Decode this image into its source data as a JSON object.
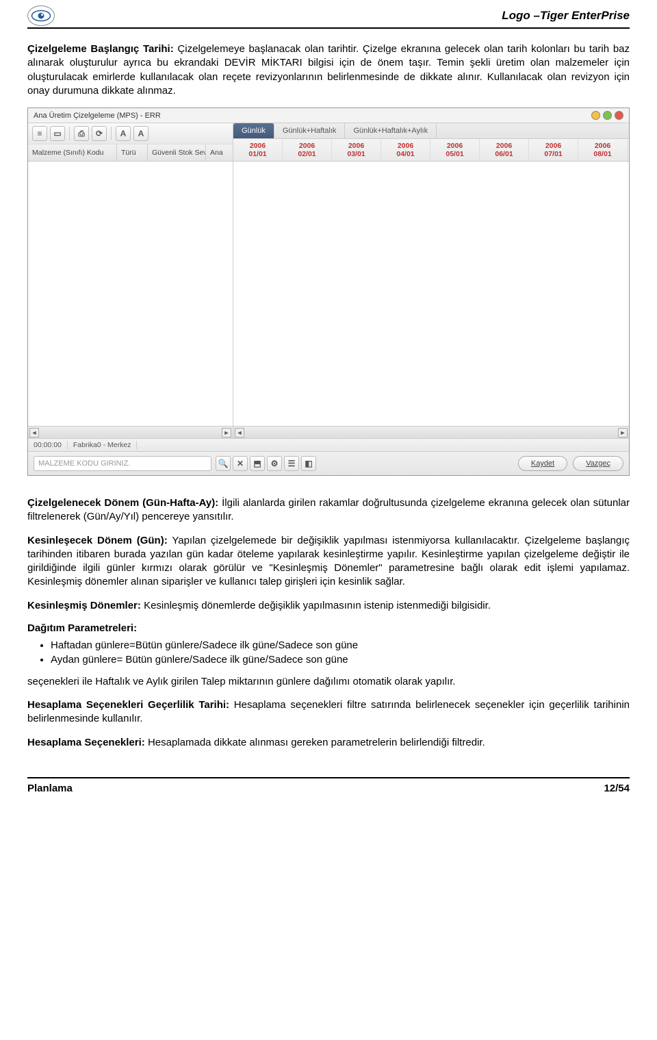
{
  "header": {
    "brand": "Logo –Tiger EnterPrise"
  },
  "paragraphs": {
    "p1_label": "Çizelgeleme Başlangıç Tarihi:",
    "p1_text": " Çizelgelemeye başlanacak olan tarihtir. Çizelge ekranına gelecek olan tarih kolonları bu tarih baz alınarak oluşturulur ayrıca bu ekrandaki DEVİR MİKTARI bilgisi için de önem taşır. Temin şekli üretim olan malzemeler için oluşturulacak emirlerde kullanılacak olan reçete revizyonlarının belirlenmesinde de dikkate alınır. Kullanılacak olan revizyon için onay durumuna dikkate alınmaz.",
    "p2_label": "Çizelgelenecek Dönem (Gün-Hafta-Ay):",
    "p2_text": " İlgili alanlarda girilen rakamlar doğrultusunda çizelgeleme ekranına gelecek olan sütunlar filtrelenerek (Gün/Ay/Yıl) pencereye yansıtılır.",
    "p3_label": "Kesinleşecek Dönem (Gün):",
    "p3_text": " Yapılan çizelgelemede bir değişiklik yapılması istenmiyorsa kullanılacaktır. Çizelgeleme başlangıç tarihinden itibaren burada yazılan gün kadar öteleme yapılarak kesinleştirme yapılır. Kesinleştirme yapılan çizelgeleme değiştir ile girildiğinde ilgili günler kırmızı olarak görülür ve \"Kesinleşmiş Dönemler\" parametresine bağlı olarak edit işlemi yapılamaz. Kesinleşmiş dönemler alınan siparişler ve kullanıcı talep girişleri için kesinlik sağlar.",
    "p4_label": "Kesinleşmiş Dönemler:",
    "p4_text": " Kesinleşmiş dönemlerde değişiklik yapılmasının istenip istenmediği bilgisidir.",
    "p5_label": "Dağıtım Parametreleri:",
    "bullet1": "Haftadan günlere=Bütün günlere/Sadece ilk güne/Sadece son güne",
    "bullet2": "Aydan günlere= Bütün günlere/Sadece ilk güne/Sadece son güne",
    "p6_text": "seçenekleri ile Haftalık ve Aylık girilen Talep miktarının günlere dağılımı otomatik olarak yapılır.",
    "p7_label": "Hesaplama Seçenekleri Geçerlilik Tarihi:",
    "p7_text": " Hesaplama seçenekleri filtre satırında belirlenecek seçenekler için geçerlilik tarihinin belirlenmesinde kullanılır.",
    "p8_label": "Hesaplama Seçenekleri:",
    "p8_text": " Hesaplamada dikkate alınması gereken parametrelerin belirlendiği filtredir."
  },
  "app": {
    "title": "Ana Üretim Çizelgeleme (MPS) - ERR",
    "left_columns": [
      "Malzeme (Sınıfı) Kodu",
      "Türü",
      "Güvenli Stok Seviyesi (a)",
      "Ana"
    ],
    "right_tabs": [
      "Günlük",
      "Günlük+Haftalık",
      "Günlük+Haftalık+Aylık"
    ],
    "dates": [
      {
        "y": "2006",
        "d": "01/01"
      },
      {
        "y": "2006",
        "d": "02/01"
      },
      {
        "y": "2006",
        "d": "03/01"
      },
      {
        "y": "2006",
        "d": "04/01"
      },
      {
        "y": "2006",
        "d": "05/01"
      },
      {
        "y": "2006",
        "d": "06/01"
      },
      {
        "y": "2006",
        "d": "07/01"
      },
      {
        "y": "2006",
        "d": "08/01"
      }
    ],
    "status": {
      "time": "00:00:00",
      "location": "Fabrika0 - Merkez"
    },
    "search_placeholder": "MALZEME KODU GIRINIZ.",
    "save_label": "Kaydet",
    "cancel_label": "Vazgeç",
    "tb_a": "A",
    "tb_a2": "A"
  },
  "footer": {
    "left": "Planlama",
    "right": "12/54"
  }
}
